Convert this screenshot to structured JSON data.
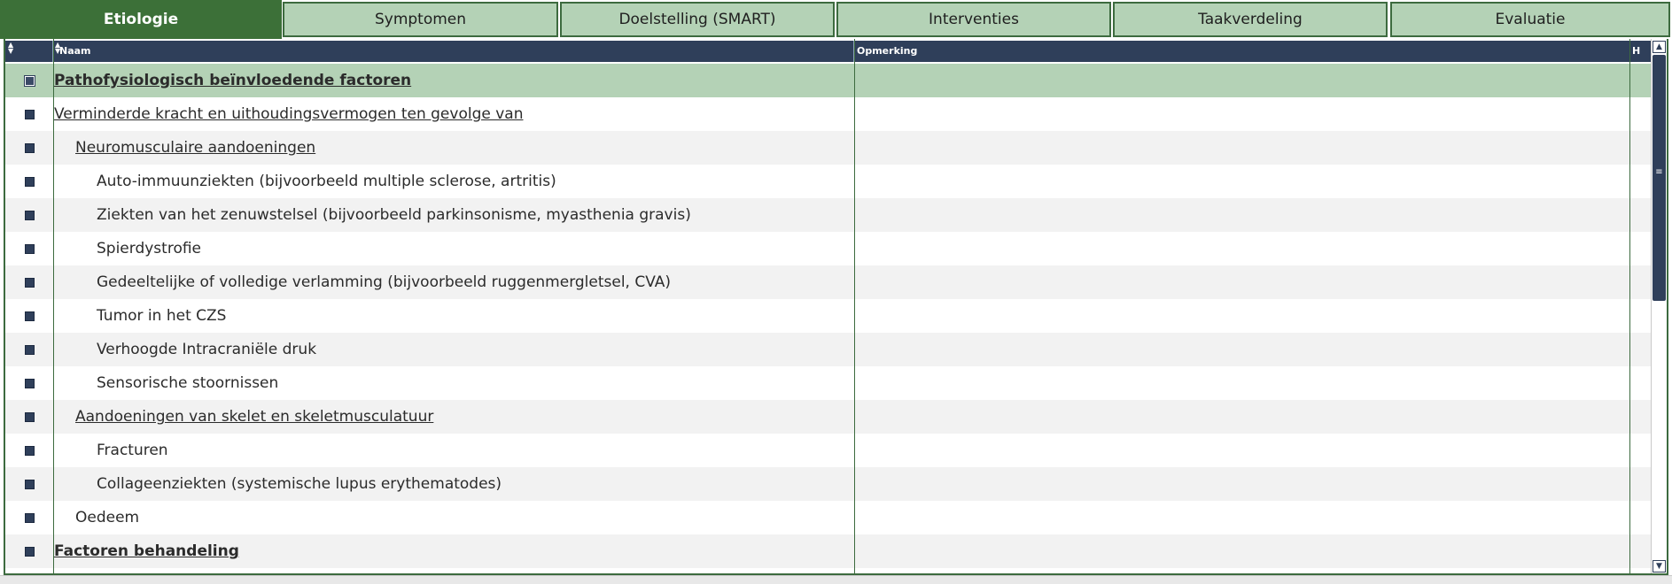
{
  "tabs": [
    {
      "label": "Etiologie",
      "active": true
    },
    {
      "label": "Symptomen",
      "active": false
    },
    {
      "label": "Doelstelling (SMART)",
      "active": false
    },
    {
      "label": "Interventies",
      "active": false
    },
    {
      "label": "Taakverdeling",
      "active": false
    },
    {
      "label": "Evaluatie",
      "active": false
    }
  ],
  "table": {
    "columns": {
      "naam": "Naam",
      "opmerking": "Opmerking",
      "h": "H"
    },
    "rows": [
      {
        "naam": "Pathofysiologisch beïnvloedende factoren",
        "level": 0,
        "opmerking": ""
      },
      {
        "naam": "Verminderde kracht en uithoudingsvermogen ten gevolge van",
        "level": 1,
        "opmerking": ""
      },
      {
        "naam": "Neuromusculaire aandoeningen",
        "level": 2,
        "opmerking": ""
      },
      {
        "naam": "Auto-immuunziekten (bijvoorbeeld multiple sclerose, artritis)",
        "level": 3,
        "opmerking": ""
      },
      {
        "naam": "Ziekten van het zenuwstelsel (bijvoorbeeld parkinsonisme, myasthenia gravis)",
        "level": 3,
        "opmerking": ""
      },
      {
        "naam": "Spierdystrofie",
        "level": 3,
        "opmerking": ""
      },
      {
        "naam": "Gedeeltelijke of volledige verlamming (bijvoorbeeld ruggenmergletsel, CVA)",
        "level": 3,
        "opmerking": ""
      },
      {
        "naam": "Tumor in het CZS",
        "level": 3,
        "opmerking": ""
      },
      {
        "naam": "Verhoogde Intracraniële druk",
        "level": 3,
        "opmerking": ""
      },
      {
        "naam": "Sensorische stoornissen",
        "level": 3,
        "opmerking": ""
      },
      {
        "naam": "Aandoeningen van skelet en skeletmusculatuur",
        "level": 2,
        "opmerking": ""
      },
      {
        "naam": "Fracturen",
        "level": 3,
        "opmerking": ""
      },
      {
        "naam": "Collageenziekten (systemische lupus erythematodes)",
        "level": 3,
        "opmerking": ""
      },
      {
        "naam": "Oedeem",
        "level": "2-plain",
        "opmerking": ""
      },
      {
        "naam": "Factoren behandeling",
        "level": 0,
        "opmerking": ""
      }
    ]
  },
  "icons": {
    "sort": "sort-icon",
    "checkbox": "checkbox-icon",
    "scroll_up": "chevron-up-icon",
    "scroll_down": "chevron-down-icon"
  },
  "colors": {
    "tab_active": "#3c7038",
    "tab_inactive": "#b4d2b6",
    "header_bg": "#2f3f5a",
    "heading_row": "#b4d2b6",
    "alt_row": "#f2f2f2"
  }
}
